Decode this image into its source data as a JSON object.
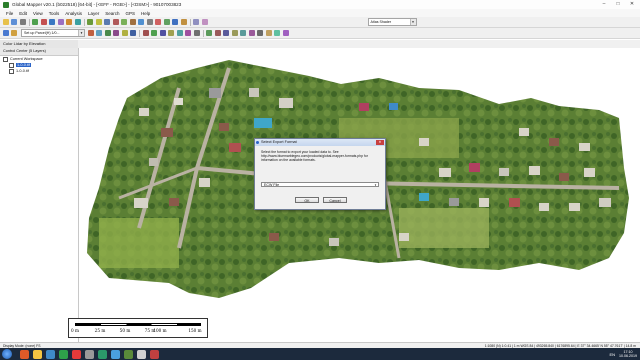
{
  "window": {
    "title": "Global Mapper v20.1 (b022518) [64-bit] - [<EFF - RGB>] - [<DSM>] - 90107003823",
    "controls": {
      "minimize": "–",
      "maximize": "□",
      "close": "✕"
    }
  },
  "menu": [
    "File",
    "Edit",
    "View",
    "Tools",
    "Analysis",
    "Layer",
    "Search",
    "GPS",
    "Help"
  ],
  "toolbar": {
    "shader": "Atlas Shader",
    "style_combo": "Set up Parcel(H) 1/0...",
    "layer_style": "Color Lidar by Elevation"
  },
  "control_center": {
    "title": "Control Center (5 Layers)",
    "root": "Current Workspace",
    "layers": [
      "1-0-0.tif",
      "1-0-0.tif"
    ]
  },
  "scalebar": {
    "ticks": [
      "0 m",
      "25 m",
      "50 m",
      "75 m",
      "100 m",
      "150 m"
    ]
  },
  "dialog": {
    "title": "Select Export Format",
    "message": "Select the format to export your loaded data to. See http://www.bluemarblegeo.com/products/global-mapper-formats.php for information on the available formats.",
    "selected_format": "ECW File",
    "ok": "OK",
    "cancel": "Cancel",
    "close": "✕"
  },
  "status": {
    "left": "Display Mode: (none) FS",
    "right": "1:1080 (N) 1:0.41 | 1 m WGS 84 | 493265.840 | 6176895.64 | E 37° 34.4665' N 55° 47.7617' | 14.8 m"
  },
  "taskbar": {
    "lang": "EN",
    "time": "17:10",
    "date": "10.06.2019"
  },
  "colors": {
    "accent": "#2b64c8",
    "taskbar": "#1c2a3d",
    "selection": "#2b64c8"
  }
}
